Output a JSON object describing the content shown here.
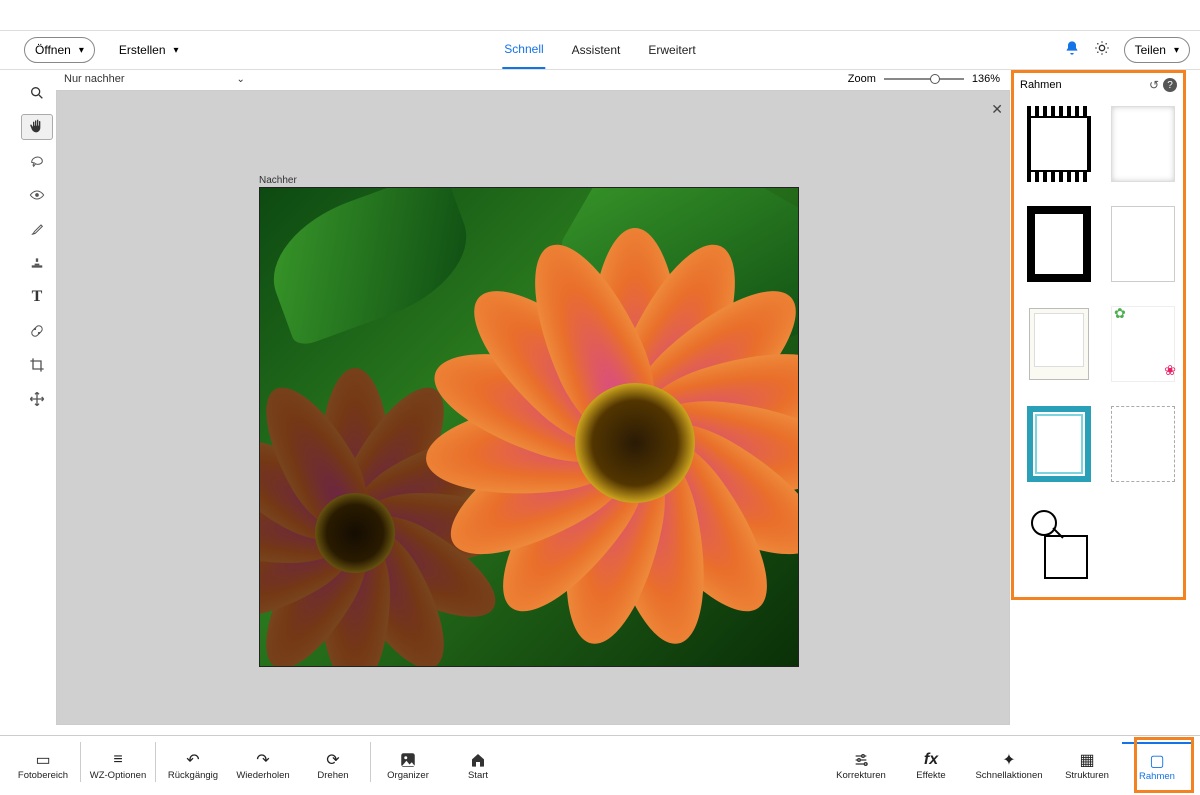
{
  "top": {
    "open": "Öffnen",
    "erstellen": "Erstellen",
    "tabs": {
      "schnell": "Schnell",
      "assistent": "Assistent",
      "erweitert": "Erweitert"
    },
    "teilen": "Teilen"
  },
  "infobar": {
    "view": "Nur nachher"
  },
  "zoom": {
    "label": "Zoom",
    "value": "136%"
  },
  "canvas": {
    "label": "Nachher"
  },
  "panel": {
    "title": "Rahmen"
  },
  "bottom": {
    "fotobereich": "Fotobereich",
    "wzoptionen": "WZ-Optionen",
    "rueckgaengig": "Rückgängig",
    "wiederholen": "Wiederholen",
    "drehen": "Drehen",
    "organizer": "Organizer",
    "start": "Start",
    "korrekturen": "Korrekturen",
    "effekte": "Effekte",
    "schnellaktionen": "Schnellaktionen",
    "strukturen": "Strukturen",
    "rahmen": "Rahmen"
  }
}
